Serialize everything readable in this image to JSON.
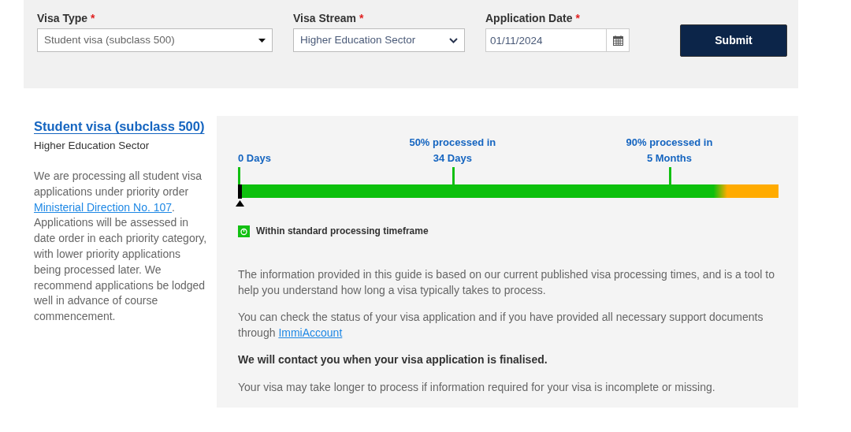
{
  "form": {
    "fields": [
      {
        "kind": "select",
        "label": "Visa Type",
        "required_mark": "*",
        "value": "Student visa (subclass 500)"
      },
      {
        "kind": "dropdown",
        "label": "Visa Stream",
        "required_mark": "*",
        "value": "Higher Education Sector"
      },
      {
        "kind": "date",
        "label": "Application Date",
        "required_mark": "*",
        "value": "01/11/2024"
      }
    ],
    "submit": "Submit"
  },
  "summary": {
    "title": "Student visa (subclass 500)",
    "subtitle": "Higher Education Sector",
    "note": {
      "before": "We are processing all student visa applications under priority order ",
      "link": "Ministerial Direction No. 107",
      "after": ". Applications will be assessed in date order in each priority category, with lower priority applications being processed later. We recommend applications be lodged well in advance of course commencement."
    }
  },
  "timeline": {
    "milestones": [
      {
        "lines": [
          "0 Days"
        ]
      },
      {
        "lines": [
          "50% processed in",
          "34 Days"
        ]
      },
      {
        "lines": [
          "90% processed in",
          "5 Months"
        ]
      }
    ],
    "status": "Within standard processing timeframe"
  },
  "info": [
    {
      "kind": "plain",
      "text": "The information provided in this guide is based on our current published visa processing times, and is a tool to help you understand how long a visa typically takes to process."
    },
    {
      "kind": "link",
      "text": "You can check the status of your visa application and if you have provided all necessary support documents through ",
      "link": "ImmiAccount"
    },
    {
      "kind": "bold",
      "text": "We will contact you when your visa application is finalised."
    },
    {
      "kind": "plain",
      "text": "Your visa may take longer to process if information required for your visa is incomplete or missing."
    }
  ]
}
